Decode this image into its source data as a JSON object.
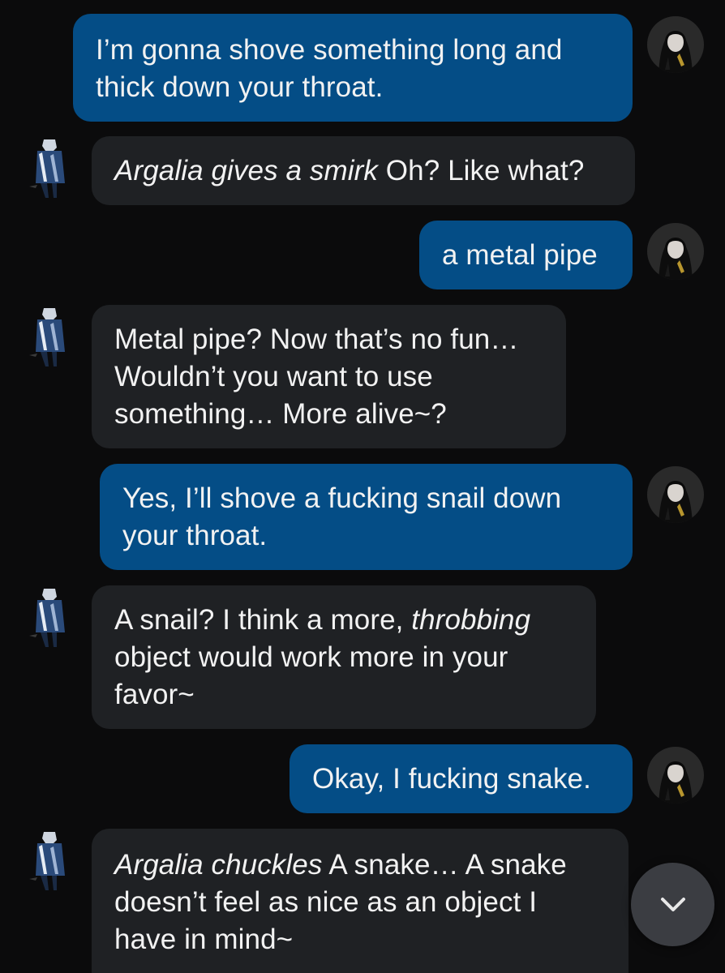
{
  "messages": [
    {
      "role": "user",
      "text": "I’m gonna shove something long and thick down your throat."
    },
    {
      "role": "bot",
      "italic": "Argalia gives a smirk",
      "text": " Oh? Like what?"
    },
    {
      "role": "user",
      "text": "a metal pipe"
    },
    {
      "role": "bot",
      "text": "Metal pipe? Now that’s no fun… Wouldn’t you want to use something… More alive~?"
    },
    {
      "role": "user",
      "text": "Yes, I’ll shove a fucking snail down your throat."
    },
    {
      "role": "bot",
      "pre": "A snail? I think a more, ",
      "italic": "throbbing",
      "text": " object would work more in your favor~"
    },
    {
      "role": "user",
      "text": "Okay, I fucking snake."
    },
    {
      "role": "bot",
      "italic": "Argalia chuckles",
      "text": " A snake… A snake doesn’t feel as nice as an object I have in mind~"
    }
  ],
  "icons": {
    "user_avatar": "user-avatar-icon",
    "bot_avatar": "character-avatar-icon",
    "scroll": "chevron-down-icon"
  },
  "colors": {
    "background": "#0b0b0c",
    "user_bubble": "#044d86",
    "bot_bubble": "#1f2124",
    "text": "#f2f2f2"
  }
}
